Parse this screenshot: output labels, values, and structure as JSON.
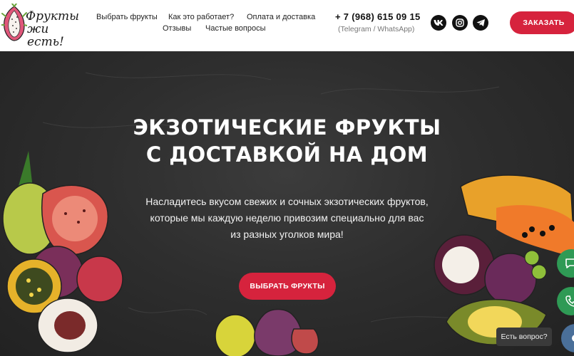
{
  "brand": {
    "logo_line1": "Фрукты",
    "logo_line2": "жи есть!"
  },
  "nav": {
    "item1": "Выбрать фрукты",
    "item2": "Как это работает?",
    "item3": "Оплата и доставка",
    "item4": "Отзывы",
    "item5": "Частые вопросы"
  },
  "contact": {
    "phone": "+ 7 (968) 615 09 15",
    "phone_note": "(Telegram / WhatsApp)"
  },
  "social": [
    "vk-icon",
    "instagram-icon",
    "telegram-icon"
  ],
  "header": {
    "order_label": "ЗАКАЗАТЬ"
  },
  "hero": {
    "title_line1": "ЭКЗОТИЧЕСКИЕ ФРУКТЫ",
    "title_line2": "С ДОСТАВКОЙ НА ДОМ",
    "sub_line1": "Насладитесь вкусом свежих и сочных экзотических фруктов,",
    "sub_line2": "которые мы каждую неделю привозим специально для вас",
    "sub_line3": "из разных уголков мира!",
    "cta_label": "ВЫБРАТЬ ФРУКТЫ"
  },
  "widgets": {
    "tooltip": "Есть вопрос?"
  },
  "colors": {
    "accent": "#d6233d",
    "widget_green": "#2f9a55",
    "widget_blue": "#4a6f99",
    "board": "#2e2e2e"
  }
}
